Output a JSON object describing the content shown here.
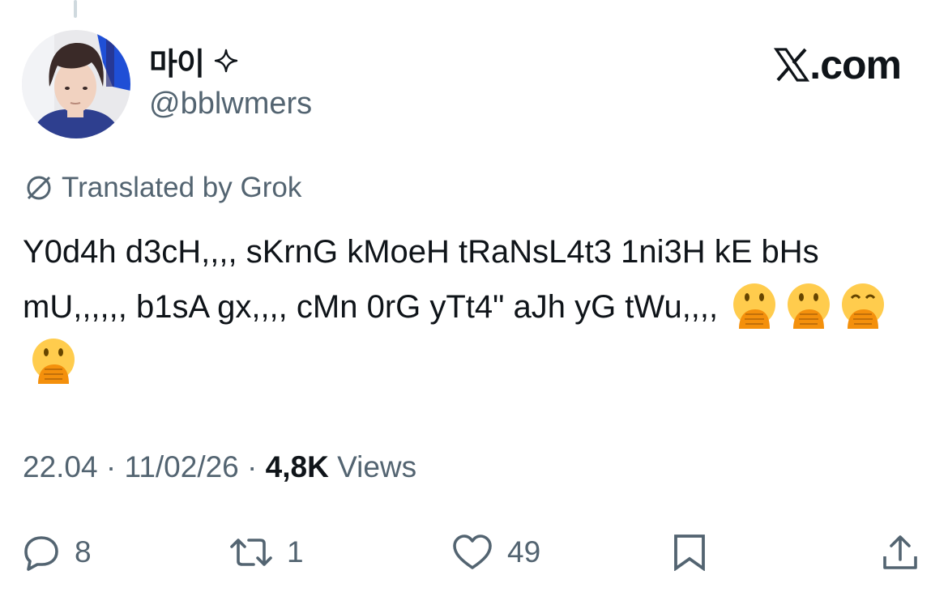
{
  "tweet": {
    "author": {
      "display_name": "마이",
      "handle": "@bblwmers"
    },
    "brand": ".com",
    "translation_note": "Translated by Grok",
    "text": "Y0d4h d3cH,,,, sKrnG kMoeH tRaNsL4t3 1ni3H kE bHs mU,,,,,, b1sA gx,,,, cMn 0rG yTt4\" aJh yG tWu,,,,",
    "emojis": [
      "face-with-hand-over-mouth",
      "face-with-hand-over-mouth",
      "smiling-face-with-hand-over-mouth",
      "face-with-hand-over-mouth"
    ],
    "meta": {
      "time": "22.04",
      "date": "11/02/26",
      "views_count": "4,8K",
      "views_label": "Views",
      "separator": "·"
    },
    "actions": {
      "replies": "8",
      "reposts": "1",
      "likes": "49"
    }
  },
  "icons": [
    "reply-icon",
    "repost-icon",
    "like-icon",
    "bookmark-icon",
    "share-icon",
    "sparkle-icon",
    "translate-icon",
    "x-logo-icon"
  ],
  "colors": {
    "text": "#0f1419",
    "secondary": "#536471",
    "background": "#ffffff",
    "emoji_face": "#FFCC4D",
    "emoji_hand": "#F4900C"
  }
}
